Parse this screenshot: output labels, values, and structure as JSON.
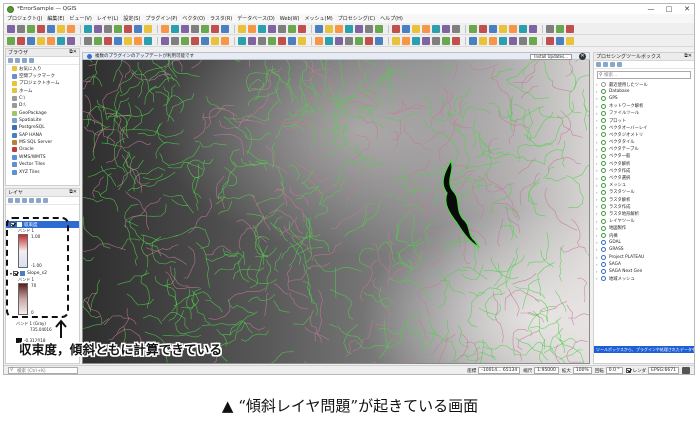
{
  "window": {
    "title": "*ErrorSample — QGIS",
    "controls": [
      "—",
      "□",
      "✕"
    ]
  },
  "menu": [
    "プロジェクト(J)",
    "編集(E)",
    "ビュー(V)",
    "レイヤ(L)",
    "設定(S)",
    "プラグイン(P)",
    "ベクタ(O)",
    "ラスタ(R)",
    "データベース(D)",
    "Web(W)",
    "メッシュ(M)",
    "プロセシング(C)",
    "ヘルプ(H)"
  ],
  "browser_panel": {
    "title": "ブラウザ",
    "items": [
      {
        "label": "お気に入り",
        "color": "#e8c23a"
      },
      {
        "label": "空間ブックマーク",
        "color": "#6b8fc9"
      },
      {
        "label": "プロジェクトホーム",
        "color": "#e8c23a"
      },
      {
        "label": "ホーム",
        "color": "#e8c23a"
      },
      {
        "label": "C:\\",
        "color": "#9a9a9a"
      },
      {
        "label": "D:\\",
        "color": "#9a9a9a"
      },
      {
        "label": "GeoPackage",
        "color": "#a0c46a"
      },
      {
        "label": "SpatiaLite",
        "color": "#7aa0cf"
      },
      {
        "label": "PostgreSQL",
        "color": "#3c6ea8"
      },
      {
        "label": "SAP HANA",
        "color": "#4a7fc0"
      },
      {
        "label": "MS SQL Server",
        "color": "#b9823a"
      },
      {
        "label": "Oracle",
        "color": "#c43a3a"
      },
      {
        "label": "WMS/WMTS",
        "color": "#5d8fd1"
      },
      {
        "label": "Vector Tiles",
        "color": "#5d8fd1"
      },
      {
        "label": "XYZ Tiles",
        "color": "#5d8fd1"
      }
    ]
  },
  "layers_panel": {
    "title": "レイヤ",
    "layer1": {
      "name": "収束度",
      "band": "バンド 1",
      "max": "1.00",
      "min": "-1.00"
    },
    "layer2": {
      "name": "Slope_s2",
      "band": "バンド 1",
      "max": "70",
      "min": "0"
    },
    "layer3": {
      "name": "バンド 1 (Gray)",
      "max": "735.04016",
      "min": "-0.312018"
    }
  },
  "message_bar": {
    "text": "複数のプラグインのアップデートが利用可能です",
    "button": "Install Updates..."
  },
  "toolbox": {
    "title": "プロセシングツールボックス",
    "search_placeholder": "検索...",
    "items": [
      "最近使用したツール",
      "Database",
      "GPS",
      "ネットワーク解析",
      "ファイルツール",
      "プロット",
      "ベクタオーバーレイ",
      "ベクタジオメトリ",
      "ベクタタイル",
      "ベクタテーブル",
      "ベクタ一般",
      "ベクタ解析",
      "ベクタ作成",
      "ベクタ選択",
      "メッシュ",
      "ラスタツール",
      "ラスタ解析",
      "ラスタ作成",
      "ラスタ地形解析",
      "レイヤツール",
      "地図製作",
      "内挿",
      "GDAL",
      "GRASS",
      "Project PLATEAU",
      "SAGA",
      "SAGA Next Gen",
      "地域メッシュ"
    ],
    "banner": "ツールボックスから、プラグインや処理されたデータを表示するブラウザ"
  },
  "statusbar": {
    "locator_placeholder": "検索 (Ctrl+K)",
    "coord_label": "座標",
    "coord_value": "-10014... 65134",
    "scale_label": "縮尺",
    "scale_value": "1:95000",
    "magnifier_label": "拡大",
    "magnifier_value": "100%",
    "rotation_label": "回転",
    "rotation_value": "0.0 °",
    "render_label": "レンダ",
    "crs": "EPSG:6671"
  },
  "callout": "収束度，傾斜ともに計算できている",
  "caption": "▲ “傾斜レイヤ問題”が起きている画面",
  "colors": {
    "selected": "#2d6bd1",
    "contour_green": "#4fd14a",
    "contour_pink": "#c8789a",
    "gear_green": "#3f9a3f"
  }
}
